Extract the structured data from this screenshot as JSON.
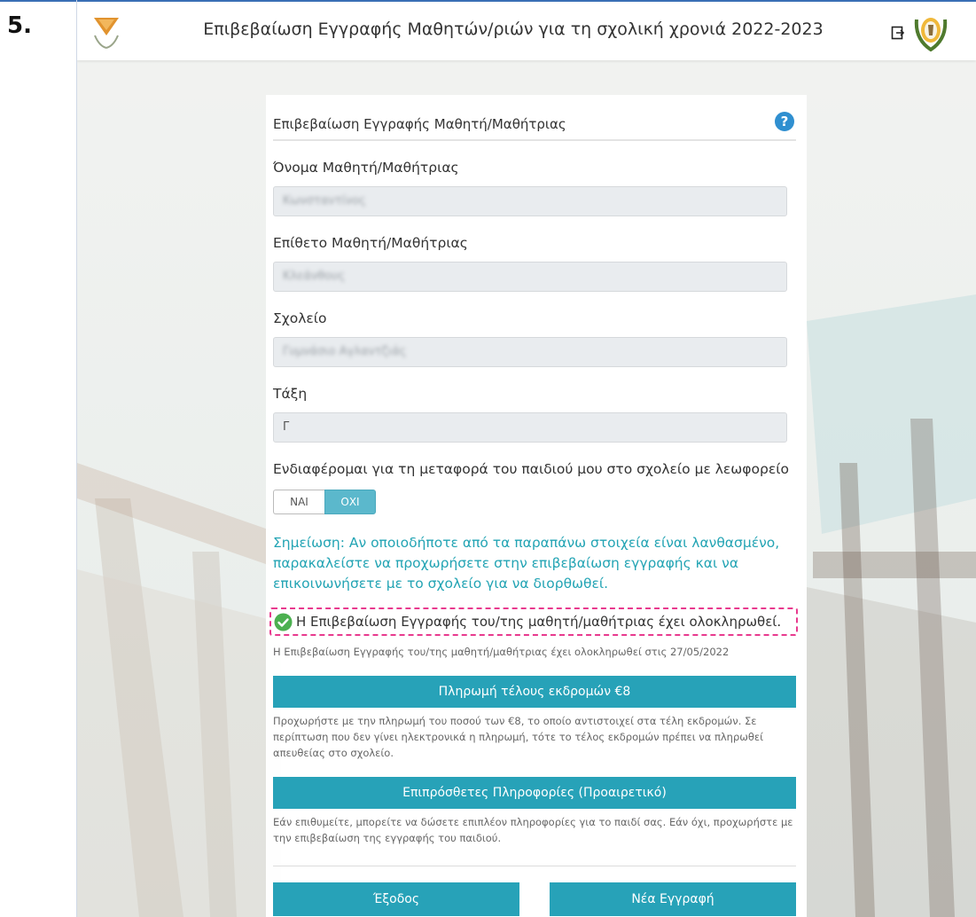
{
  "step": {
    "number": "5."
  },
  "header": {
    "title": "Επιβεβαίωση Εγγραφής Μαθητών/ριών για τη σχολική χρονιά 2022-2023",
    "left_logo_icon": "cyprus-map-emblem-icon",
    "logout_icon": "logout-icon",
    "right_logo_icon": "cyprus-coat-of-arms-icon"
  },
  "card": {
    "title": "Επιβεβαίωση Εγγραφής Μαθητή/Μαθήτριας",
    "help_icon": "?",
    "fields": [
      {
        "label": "Όνομα Μαθητή/Μαθήτριας",
        "value": "Κωνσταντίνος",
        "obscured": true
      },
      {
        "label": "Επίθετο Μαθητή/Μαθήτριας",
        "value": "Κλεάνθους",
        "obscured": true
      },
      {
        "label": "Σχολείο",
        "value": "Γυμνάσιο Αγλαντζιάς",
        "obscured": true
      },
      {
        "label": "Τάξη",
        "value": "Γ",
        "obscured": false
      }
    ],
    "transport": {
      "label": "Ενδιαφέρομαι για τη μεταφορά του παιδιού μου στο σχολείο με λεωφορείο",
      "yes_label": "ΝΑΙ",
      "no_label": "ΟΧΙ",
      "selected": "ΟΧΙ"
    },
    "note": "Σημείωση: Αν οποιοδήποτε από τα παραπάνω στοιχεία είναι λανθασμένο, παρακαλείστε να προχωρήσετε στην επιβεβαίωση εγγραφής και να επικοινωνήσετε με το σχολείο για να διορθωθεί.",
    "completion": {
      "message": "Η Επιβεβαίωση Εγγραφής του/της μαθητή/μαθήτριας έχει ολοκληρωθεί.",
      "date_text": "Η Επιβεβαίωση Εγγραφής του/της μαθητή/μαθήτριας έχει ολοκληρωθεί στις 27/05/2022"
    },
    "payment": {
      "button_label": "Πληρωμή τέλους εκδρομών €8",
      "description": "Προχωρήστε με την πληρωμή του ποσού των €8, το οποίο αντιστοιχεί στα τέλη εκδρομών. Σε περίπτωση που δεν γίνει ηλεκτρονικά η πληρωμή, τότε το τέλος εκδρομών πρέπει να πληρωθεί απευθείας στο σχολείο."
    },
    "additional_info": {
      "button_label": "Επιπρόσθετες Πληροφορίες (Προαιρετικό)",
      "description": "Εάν επιθυμείτε, μπορείτε να δώσετε επιπλέον πληροφορίες για το παιδί σας. Εάν όχι, προχωρήστε με την επιβεβαίωση της εγγραφής του παιδιού."
    },
    "exit_label": "Έξοδος",
    "new_registration_label": "Νέα Εγγραφή"
  },
  "colors": {
    "accent": "#27a2b8",
    "note_text": "#23a4b4",
    "help_blue": "#2f8fd0",
    "success_green": "#4cb050",
    "highlight_border": "#e83a8e"
  }
}
